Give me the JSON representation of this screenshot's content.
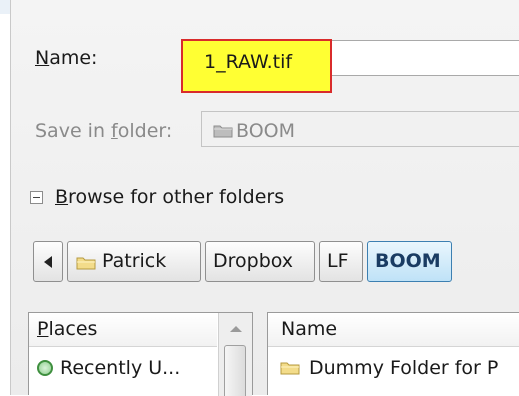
{
  "form": {
    "name_label_u": "N",
    "name_label_rest": "ame:",
    "name_value": "1_RAW.tif",
    "folder_label_a": "Save in ",
    "folder_label_u": "f",
    "folder_label_b": "older:",
    "folder_value": "BOOM",
    "browse_label_u": "B",
    "browse_label_rest": "rowse for other folders"
  },
  "breadcrumb": [
    "Patrick",
    "Dropbox",
    "LF",
    "BOOM"
  ],
  "places": {
    "header_u": "P",
    "header_rest": "laces",
    "items": [
      "Recently U..."
    ]
  },
  "files": {
    "column_header": "Name",
    "rows": [
      "Dummy Folder for P"
    ]
  },
  "colors": {
    "highlight": "#ffff33",
    "highlight_border": "#d92b2b",
    "active_crumb": "#bfe2f7"
  },
  "icons": {
    "folder": "folder-icon",
    "recent": "recent-icon",
    "back": "back-arrow-icon"
  }
}
